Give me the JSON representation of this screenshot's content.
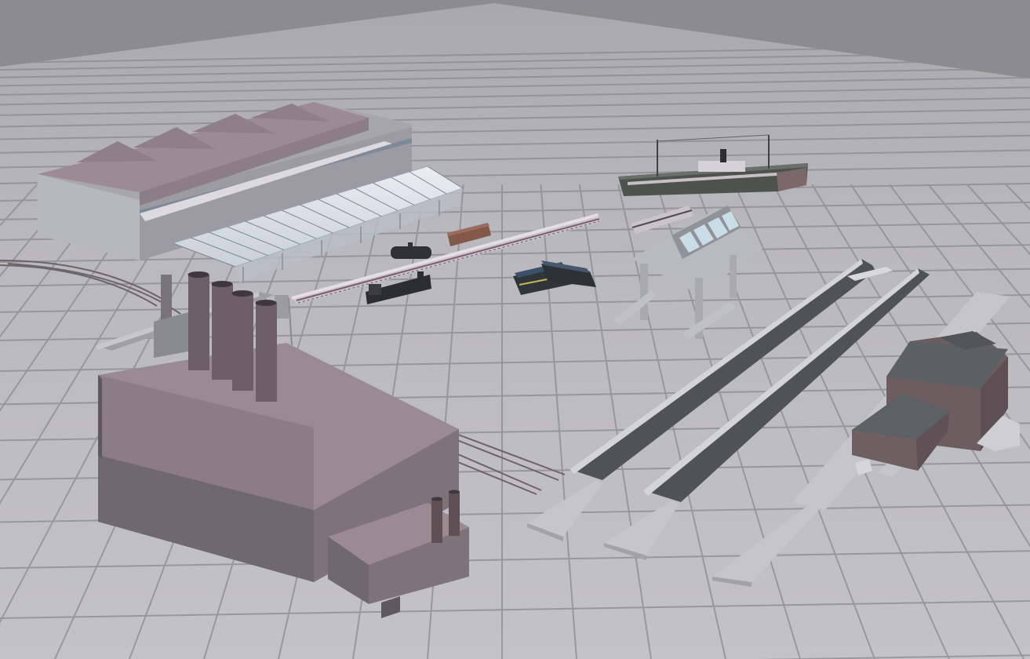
{
  "scene": {
    "view": "3d-viewport",
    "ground": "grid",
    "colors": {
      "sky": "#8c8b8e",
      "ground": "#bbbac0",
      "grid_line": "#8b8a90",
      "building_roof": "#9a8a91",
      "building_wall": "#6f6870",
      "platform_surface": "#4f5354",
      "platform_base": "#c4c3c8",
      "ship_hull": "#4d524c",
      "ship_deck": "#c8c1c6"
    },
    "objects": [
      {
        "name": "engine-shed",
        "kind": "building"
      },
      {
        "name": "glass-train-shed",
        "kind": "canopy"
      },
      {
        "name": "power-station",
        "kind": "building"
      },
      {
        "name": "steamship",
        "kind": "vessel"
      },
      {
        "name": "passenger-train",
        "kind": "rolling-stock"
      },
      {
        "name": "steam-locomotive",
        "kind": "rolling-stock"
      },
      {
        "name": "diesel-locomotives",
        "kind": "rolling-stock"
      },
      {
        "name": "freight-cars",
        "kind": "rolling-stock"
      },
      {
        "name": "signal-gantry",
        "kind": "structure"
      },
      {
        "name": "station-platforms",
        "kind": "structure"
      },
      {
        "name": "station-building",
        "kind": "building"
      },
      {
        "name": "coal-conveyor",
        "kind": "structure"
      },
      {
        "name": "railway-tracks",
        "kind": "track"
      }
    ]
  }
}
